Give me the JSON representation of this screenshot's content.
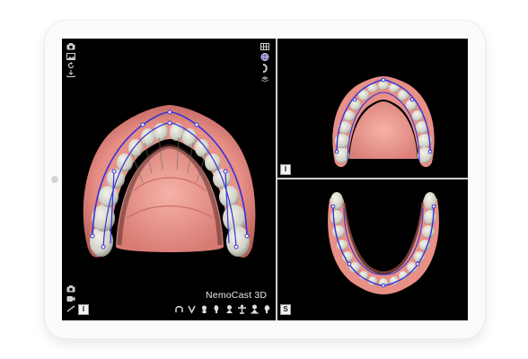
{
  "app": {
    "brand": "NemoCast 3D"
  },
  "views": {
    "main_label": "I",
    "top_right_label": "I",
    "bottom_right_label": "S"
  },
  "left_toolbar": {
    "top_icons": [
      "camera-icon",
      "image-icon",
      "rotate-icon",
      "download-icon"
    ],
    "bottom_icons": [
      "camera-icon",
      "video-icon",
      "ruler-icon"
    ]
  },
  "right_toolbar": {
    "icons": [
      "grid-icon",
      "globe-icon",
      "arch-icon",
      "layer-icon"
    ]
  },
  "view_bar": {
    "icons": [
      "both-arches-icon",
      "upper-arch-icon",
      "front-view-icon",
      "left-view-icon",
      "right-view-icon",
      "top-view-icon",
      "bottom-view-icon",
      "side-view-icon"
    ]
  },
  "colors": {
    "gingiva": "#e88f86",
    "gingiva_dark": "#c96a63",
    "tooth": "#dcdcd2",
    "tooth_shadow": "#9a9a90",
    "arch_curve": "#3232d8",
    "background": "#000000"
  }
}
